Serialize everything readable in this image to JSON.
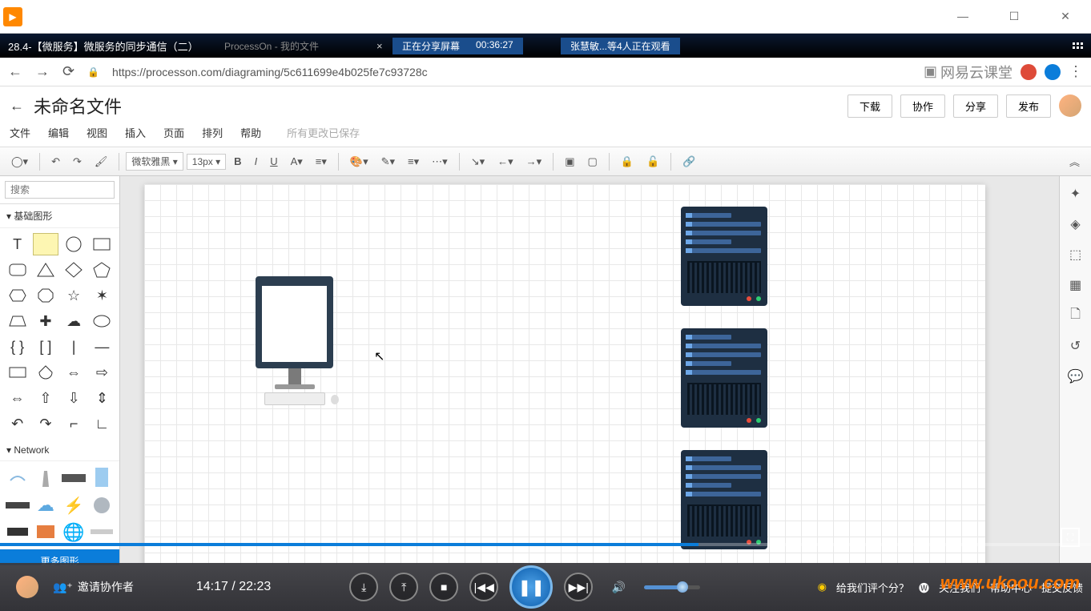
{
  "window": {
    "minimize": "—",
    "maximize": "☐",
    "close": "✕"
  },
  "video_title": "28.4-【微服务】微服务的同步通信（二）",
  "processon_tab": "ProcessOn - 我的文件",
  "share": {
    "label": "正在分享屏幕",
    "time": "00:36:27"
  },
  "viewers": "张慧敏...等4人正在观看",
  "browser": {
    "url": "https://processon.com/diagraming/5c611699e4b025fe7c93728c",
    "brand": "网易云课堂"
  },
  "doc": {
    "title": "未命名文件",
    "save_status": "所有更改已保存"
  },
  "header_buttons": {
    "download": "下载",
    "collab": "协作",
    "share": "分享",
    "publish": "发布"
  },
  "menus": {
    "file": "文件",
    "edit": "编辑",
    "view": "视图",
    "insert": "插入",
    "page": "页面",
    "arrange": "排列",
    "help": "帮助"
  },
  "toolbar": {
    "font": "微软雅黑",
    "size": "13px"
  },
  "sidebar": {
    "search_placeholder": "搜索",
    "basic": "基础图形",
    "network": "Network",
    "more": "更多图形"
  },
  "playback": {
    "current": "14:17",
    "total": "22:23"
  },
  "collab_invite": "邀请协作者",
  "bottom": {
    "rate": "给我们评个分？",
    "follow": "关注我们",
    "help": "帮助中心",
    "feedback": "提交反馈"
  },
  "watermark": "www.ukoou.com"
}
